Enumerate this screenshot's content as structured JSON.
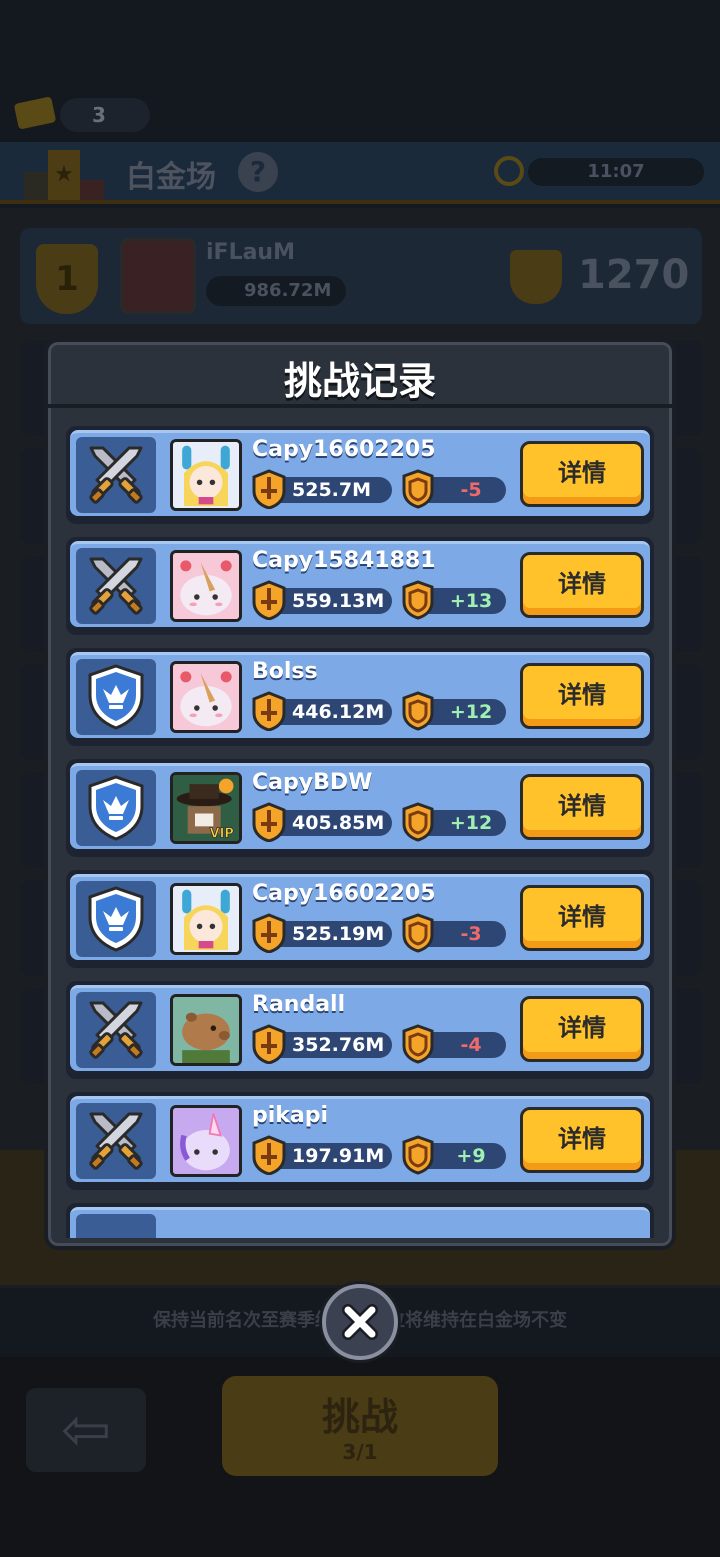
{
  "background": {
    "tickets": "3",
    "arena_title": "白金场",
    "help_symbol": "?",
    "timer": "11:07",
    "top_player": {
      "rank": "1",
      "name": "iFLauM",
      "power": "986.72M",
      "trophies": "1270"
    },
    "hint": "保持当前名次至赛季结束，段位将维持在白金场不变",
    "back_symbol": "⇦",
    "challenge_label": "挑战",
    "challenge_count": "3/1"
  },
  "modal": {
    "title": "挑战记录",
    "detail_label": "详情",
    "records": [
      {
        "result": "attack",
        "avatar": "bunny-girl",
        "name": "Capy16602205",
        "power": "525.7M",
        "trophy_delta": "-5"
      },
      {
        "result": "attack",
        "avatar": "pink-cat",
        "name": "Capy15841881",
        "power": "559.13M",
        "trophy_delta": "+13"
      },
      {
        "result": "defense",
        "avatar": "pink-cat",
        "name": "Bolss",
        "power": "446.12M",
        "trophy_delta": "+12"
      },
      {
        "result": "defense",
        "avatar": "vip-hat",
        "name": "CapyBDW",
        "power": "405.85M",
        "trophy_delta": "+12",
        "vip": "VIP"
      },
      {
        "result": "defense",
        "avatar": "bunny-girl",
        "name": "Capy16602205",
        "power": "525.19M",
        "trophy_delta": "-3"
      },
      {
        "result": "attack",
        "avatar": "capybara",
        "name": "Randall",
        "power": "352.76M",
        "trophy_delta": "-4"
      },
      {
        "result": "attack",
        "avatar": "unicorn",
        "name": "pikapi",
        "power": "197.91M",
        "trophy_delta": "+9"
      }
    ]
  },
  "colors": {
    "row_blue": "#7daae6",
    "button_yellow": "#ffc22b",
    "negative": "#f06a6a",
    "positive": "#9ff0b2"
  }
}
